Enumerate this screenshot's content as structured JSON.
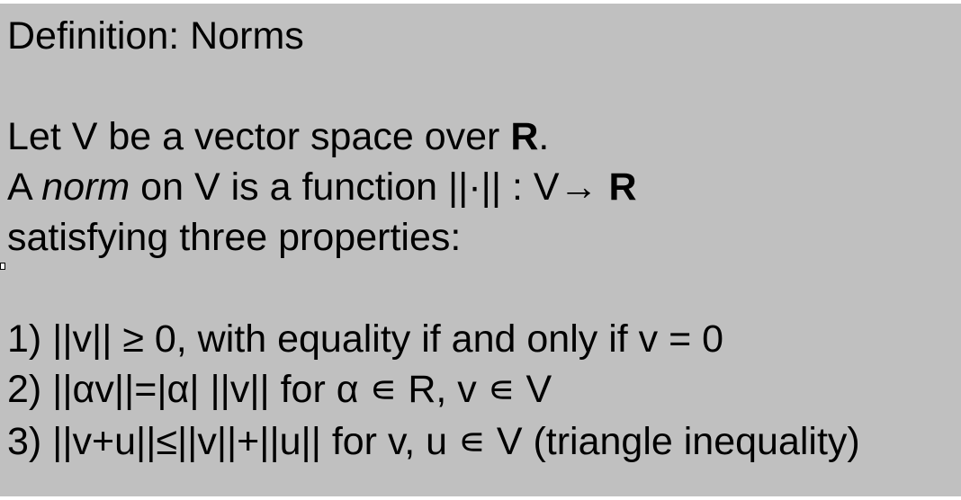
{
  "slide": {
    "title": "Definition: Norms",
    "intro": {
      "line1_a": "Let V be a vector space over ",
      "line1_bold": "R",
      "line1_b": ".",
      "line2_a": "A ",
      "line2_italic": "norm",
      "line2_b": " on V is a function ||·|| : V→ ",
      "line2_bold": "R",
      "line3": "satisfying three properties:"
    },
    "properties": [
      "1)  ||v|| ≥ 0, with equality if and only if v = 0",
      "2)  ||αv||=|α| ||v|| for α ∊ R, v ∊ V",
      "3) ||v+u||≤||v||+||u|| for v, u ∊ V (triangle inequality)"
    ]
  }
}
